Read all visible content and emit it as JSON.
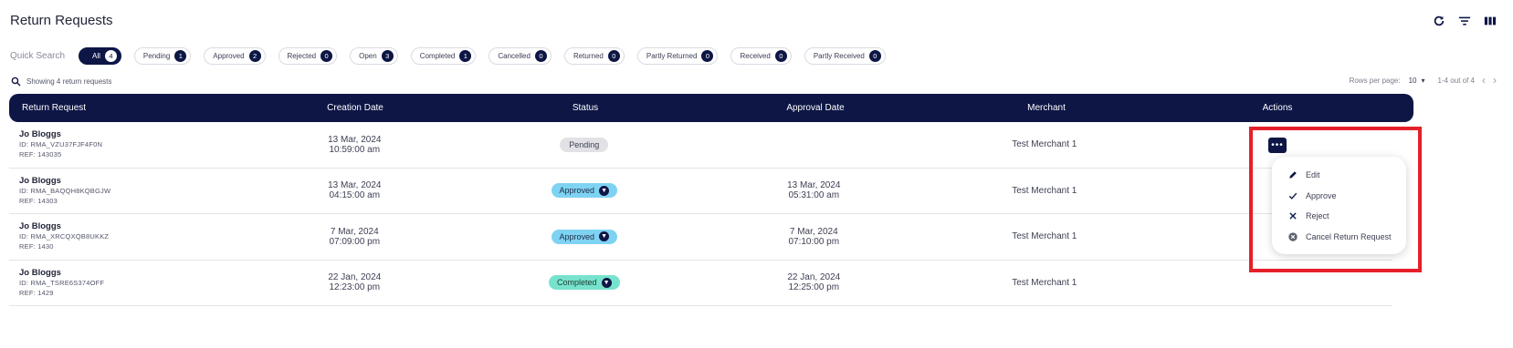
{
  "page": {
    "title": "Return Requests"
  },
  "toolbar": {
    "icons": [
      "refresh-icon",
      "filter-icon",
      "columns-icon"
    ]
  },
  "quick_search": {
    "label": "Quick Search",
    "chips": [
      {
        "label": "All",
        "count": "4",
        "active": true
      },
      {
        "label": "Pending",
        "count": "1"
      },
      {
        "label": "Approved",
        "count": "2"
      },
      {
        "label": "Rejected",
        "count": "0"
      },
      {
        "label": "Open",
        "count": "3"
      },
      {
        "label": "Completed",
        "count": "1"
      },
      {
        "label": "Cancelled",
        "count": "0"
      },
      {
        "label": "Returned",
        "count": "0"
      },
      {
        "label": "Partly Returned",
        "count": "0"
      },
      {
        "label": "Received",
        "count": "0"
      },
      {
        "label": "Partly Received",
        "count": "0"
      }
    ]
  },
  "summary": {
    "showing_text": "Showing 4 return requests"
  },
  "pagination": {
    "rows_label": "Rows per page:",
    "rows_value": "10",
    "range": "1-4 out of 4"
  },
  "table": {
    "headers": [
      "Return Request",
      "Creation Date",
      "Status",
      "Approval Date",
      "Merchant",
      "Actions"
    ],
    "rows": [
      {
        "name": "Jo Bloggs",
        "id": "ID: RMA_VZU37FJF4F0N",
        "ref": "REF: 143035",
        "created_date": "13 Mar, 2024",
        "created_time": "10:59:00 am",
        "status": "Pending",
        "approval_date": "",
        "approval_time": "",
        "merchant": "Test Merchant 1"
      },
      {
        "name": "Jo Bloggs",
        "id": "ID: RMA_BAQQH8KQBGJW",
        "ref": "REF: 14303",
        "created_date": "13 Mar, 2024",
        "created_time": "04:15:00 am",
        "status": "Approved",
        "approval_date": "13 Mar, 2024",
        "approval_time": "05:31:00 am",
        "merchant": "Test Merchant 1"
      },
      {
        "name": "Jo Bloggs",
        "id": "ID: RMA_XRCQXQB8UKKZ",
        "ref": "REF: 1430",
        "created_date": "7 Mar, 2024",
        "created_time": "07:09:00 pm",
        "status": "Approved",
        "approval_date": "7 Mar, 2024",
        "approval_time": "07:10:00 pm",
        "merchant": "Test Merchant 1"
      },
      {
        "name": "Jo Bloggs",
        "id": "ID: RMA_TSRE6S374OFF",
        "ref": "REF: 1429",
        "created_date": "22 Jan, 2024",
        "created_time": "12:23:00 pm",
        "status": "Completed",
        "approval_date": "22 Jan, 2024",
        "approval_time": "12:25:00 pm",
        "merchant": "Test Merchant 1"
      }
    ]
  },
  "actions_menu": {
    "trigger_label": "•••",
    "items": [
      {
        "label": "Edit",
        "icon": "pencil-icon"
      },
      {
        "label": "Approve",
        "icon": "check-icon"
      },
      {
        "label": "Reject",
        "icon": "x-icon"
      },
      {
        "label": "Cancel Return Request",
        "icon": "cancel-circle-icon"
      }
    ]
  },
  "colors": {
    "navy": "#0d1645",
    "approved": "#7fd3f2",
    "completed": "#77e3cc",
    "pending": "#e2e2e6",
    "highlight": "#e5202a"
  }
}
